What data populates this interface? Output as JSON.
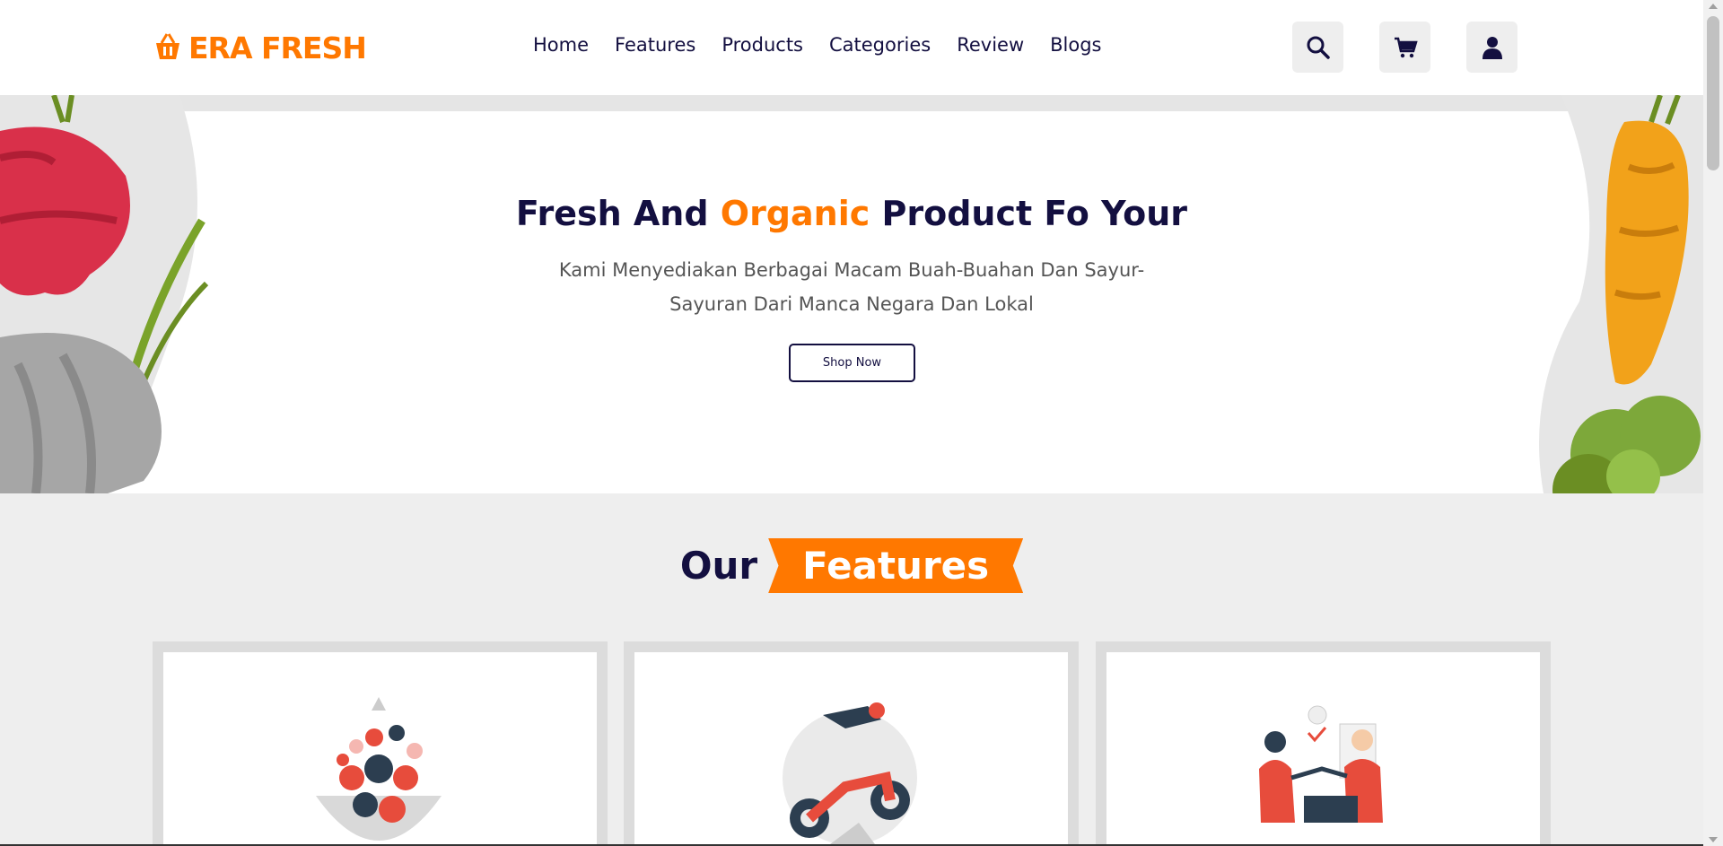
{
  "brand": {
    "name": "ERA FRESH",
    "color": "#ff7800"
  },
  "nav": {
    "items": [
      {
        "label": "Home"
      },
      {
        "label": "Features"
      },
      {
        "label": "Products"
      },
      {
        "label": "Categories"
      },
      {
        "label": "Review"
      },
      {
        "label": "Blogs"
      }
    ]
  },
  "header_icons": [
    "search-icon",
    "cart-icon",
    "user-icon"
  ],
  "hero": {
    "title_part1": "Fresh And ",
    "title_accent": "Organic",
    "title_part2": " Product Fo Your",
    "subtitle": "Kami Menyediakan Berbagai Macam Buah-Buahan Dan Sayur-Sayuran Dari Manca Negara Dan Lokal",
    "button_label": "Shop Now"
  },
  "features": {
    "heading_plain": "Our",
    "heading_tag": "Features",
    "cards": [
      {
        "illustration": "fruit-bowl-illustration"
      },
      {
        "illustration": "delivery-motorbike-illustration"
      },
      {
        "illustration": "payment-handshake-illustration"
      }
    ]
  },
  "colors": {
    "accent": "#ff7800",
    "dark": "#130f40",
    "background": "#eeeeee"
  }
}
